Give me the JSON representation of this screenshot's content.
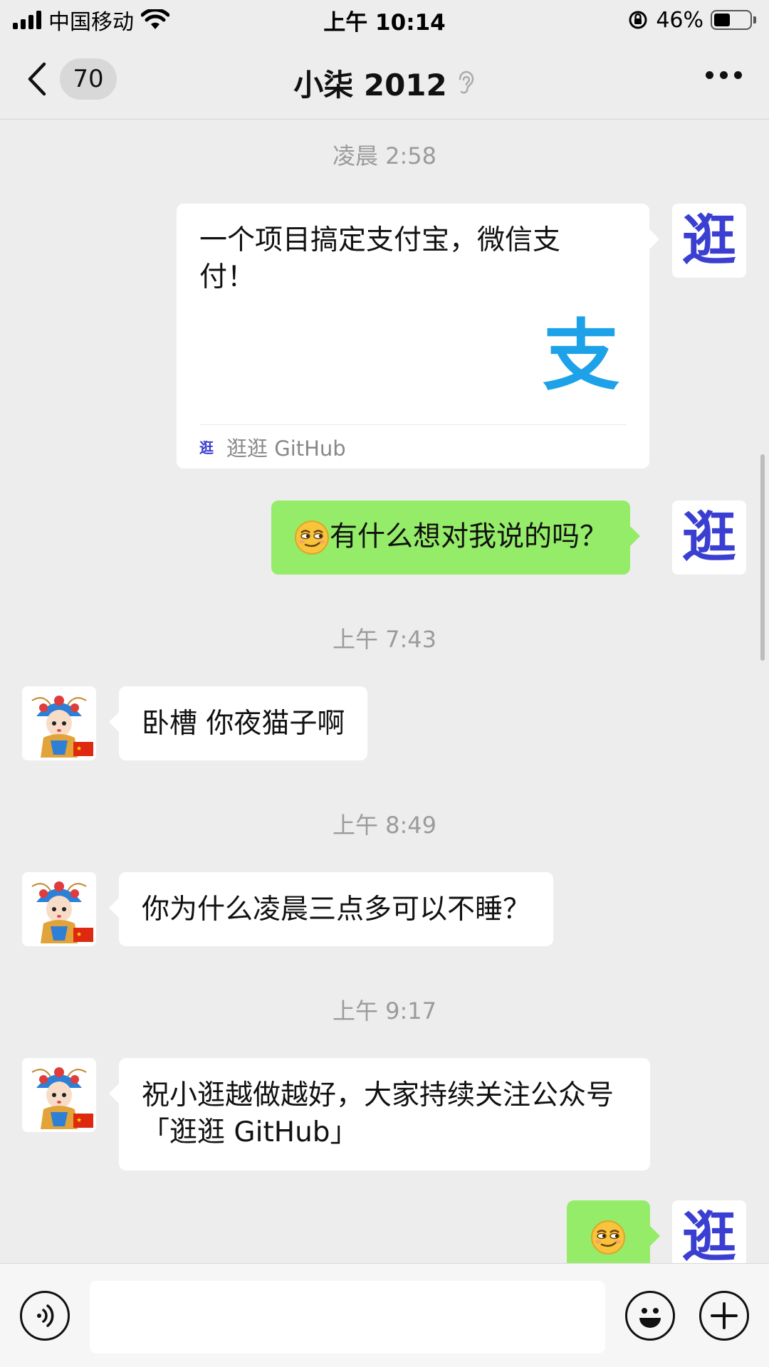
{
  "status_bar": {
    "carrier": "中国移动",
    "time": "上午 10:14",
    "battery_percent": "46%",
    "battery_level": 0.46
  },
  "nav": {
    "unread_count": "70",
    "title": "小柒 2012"
  },
  "messages": [
    {
      "type": "timestamp",
      "text": "凌晨 2:58"
    },
    {
      "type": "card",
      "side": "right",
      "title": "一个项目搞定支付宝，微信支付！",
      "logo_char": "支",
      "source_icon": "逛",
      "source": "逛逛 GitHub",
      "avatar_char": "逛"
    },
    {
      "type": "text",
      "side": "right",
      "text": "有什么想对我说的吗？",
      "emoji": "smirk-emoji",
      "avatar_char": "逛"
    },
    {
      "type": "timestamp",
      "text": "上午 7:43"
    },
    {
      "type": "text",
      "side": "left",
      "text": "卧槽 你夜猫子啊"
    },
    {
      "type": "timestamp",
      "text": "上午 8:49"
    },
    {
      "type": "text",
      "side": "left",
      "text": "你为什么凌晨三点多可以不睡？"
    },
    {
      "type": "timestamp",
      "text": "上午 9:17"
    },
    {
      "type": "text",
      "side": "left",
      "text": "祝小逛越做越好，大家持续关注公众号「逛逛 GitHub」"
    },
    {
      "type": "emoji",
      "side": "right",
      "emoji": "smirk-emoji",
      "avatar_char": "逛"
    }
  ],
  "input_bar": {
    "voice_icon": "voice-icon",
    "emoji_icon": "smiley-icon",
    "plus_icon": "plus-icon"
  },
  "colors": {
    "background": "#ededed",
    "sent_bubble": "#95ec69",
    "received_bubble": "#ffffff",
    "alipay_blue": "#1da1e8",
    "avatar_text": "#3b3fd1"
  }
}
